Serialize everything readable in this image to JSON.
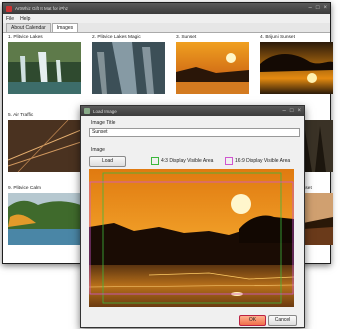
{
  "window": {
    "title": "ArtWhiz Gift It Mat for iPhz"
  },
  "menu": [
    "File",
    "Help"
  ],
  "tabs": [
    "About Calendar",
    "Images"
  ],
  "thumbnails": [
    {
      "caption": "1. Plitvice Lakes"
    },
    {
      "caption": "2. Plitvice Lakes Magic"
    },
    {
      "caption": "3. Sunset"
    },
    {
      "caption": "4. Brijuni Sunset"
    },
    {
      "caption": "5. Air Traffic"
    },
    {
      "caption": "9. Plitvice Calm"
    },
    {
      "caption": "sset"
    }
  ],
  "dialog": {
    "title": "Load Image",
    "image_title_label": "Image Title",
    "image_title_value": "Sunset",
    "image_label": "Image",
    "load_button": "Load",
    "legend_43": "4:3 Display Visible Area",
    "legend_169": "16:9 Display Visible Area",
    "ok_button": "OK",
    "cancel_button": "Cancel"
  },
  "colors": {
    "legend_43": "#3cb83c",
    "legend_169": "#d055d0",
    "ok_accent": "#ef6f4a"
  }
}
